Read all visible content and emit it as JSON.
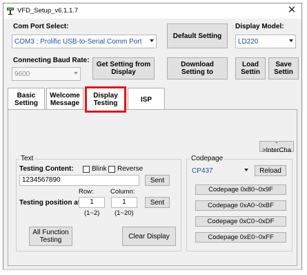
{
  "window": {
    "title": "VFD_Setup_v6.1.1.7",
    "close_glyph": "✕"
  },
  "com_port": {
    "label": "Com Port Select:",
    "value": "COM3 : Prolific USB-to-Serial Comm Port"
  },
  "buttons": {
    "default_setting": "Default Setting",
    "get_setting": "Get Setting from Display",
    "download_setting": "Download Setting to",
    "load_setting": "Load Settin",
    "save_setting": "Save Settin"
  },
  "display_model": {
    "label": "Display Model:",
    "value": "LD220"
  },
  "baud_rate": {
    "label": "Connecting Baud Rate:",
    "value": "9600"
  },
  "tabs": [
    {
      "label": "Basic Setting"
    },
    {
      "label": "Welcome Message"
    },
    {
      "label": "Display Testing",
      "active": true
    },
    {
      "label": "ISP"
    }
  ],
  "display_testing": {
    "inter_button": "->InterCha",
    "text_group": {
      "title": "Text",
      "testing_content_label": "Testing Content:",
      "blink_label": "Blink",
      "reverse_label": "Reverse",
      "content_value": "1234567890",
      "sent_label": "Sent",
      "row_label": "Row:",
      "column_label": "Column:",
      "position_label": "Testing position at:",
      "row_value": "1",
      "column_value": "1",
      "row_range": "(1~2)",
      "column_range": "(1~20)",
      "sent_position_label": "Sent",
      "all_function_label": "All Function Testing",
      "clear_display_label": "Clear Display"
    },
    "codepage_group": {
      "title": "Codepage",
      "value": "CP437",
      "reload_label": "Reload",
      "pages": [
        "Codepage 0x80~0x9F",
        "Codepage 0xA0~0xBF",
        "Codepage 0xC0~0xDF",
        "Codepage 0xE0~0xFF"
      ]
    }
  },
  "colors": {
    "active_tab_highlight": "#e4151b",
    "combo_text": "#1f4fa8",
    "button_face": "#e1e1e1"
  }
}
